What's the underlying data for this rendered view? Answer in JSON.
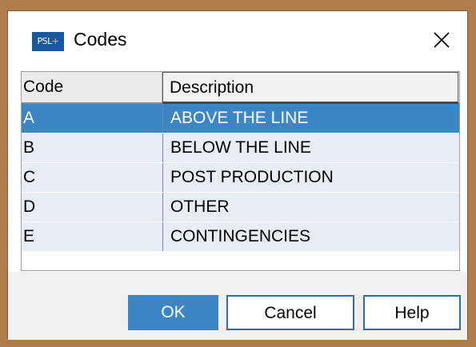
{
  "window": {
    "title": "Codes",
    "icon_text": "PSL",
    "icon_plus": "+"
  },
  "table": {
    "columns": [
      "Code",
      "Description"
    ],
    "rows": [
      {
        "code": "A",
        "description": "ABOVE THE LINE",
        "selected": true
      },
      {
        "code": "B",
        "description": "BELOW THE LINE",
        "selected": false
      },
      {
        "code": "C",
        "description": "POST PRODUCTION",
        "selected": false
      },
      {
        "code": "D",
        "description": "OTHER",
        "selected": false
      },
      {
        "code": "E",
        "description": "CONTINGENCIES",
        "selected": false
      }
    ]
  },
  "buttons": {
    "ok": "OK",
    "cancel": "Cancel",
    "help": "Help"
  },
  "colors": {
    "selection": "#3c86c6",
    "row_background": "#e6edf5",
    "footer_background": "#f0f0f0",
    "button_border": "#2e6ea8"
  },
  "icons": {
    "close": "close-icon",
    "app": "psl-app-icon"
  }
}
